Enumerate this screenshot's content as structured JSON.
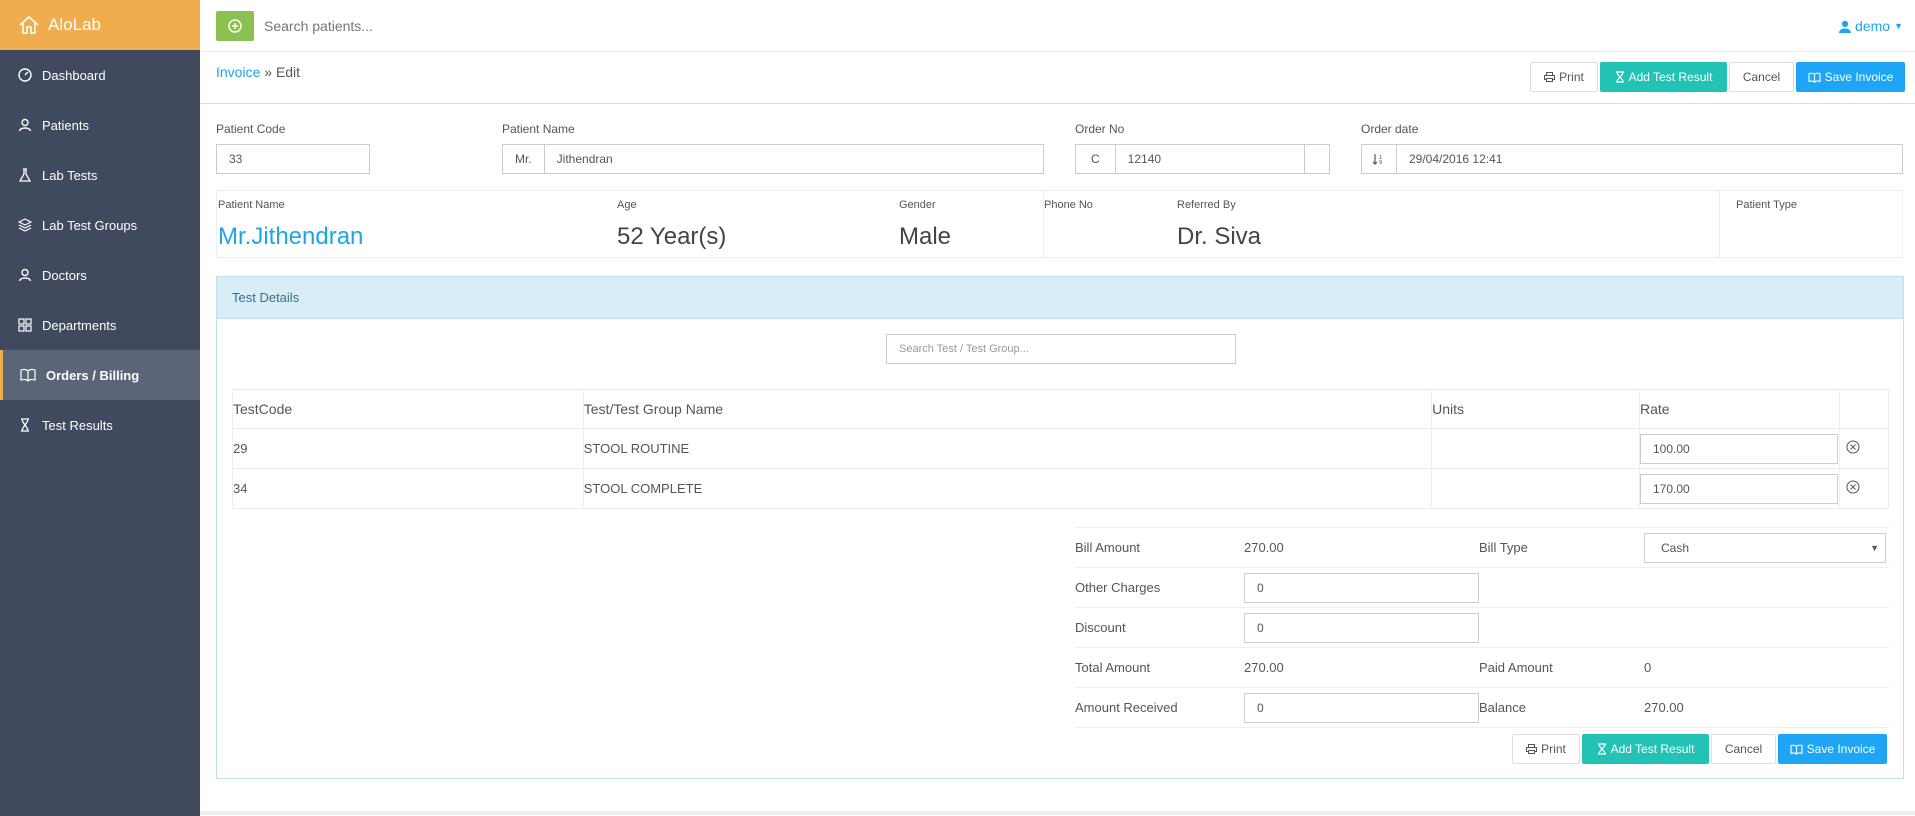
{
  "app": {
    "title": "AloLab"
  },
  "sidebar": {
    "items": [
      {
        "label": "Dashboard",
        "icon": "dashboard-icon"
      },
      {
        "label": "Patients",
        "icon": "user-icon"
      },
      {
        "label": "Lab Tests",
        "icon": "flask-icon"
      },
      {
        "label": "Lab Test Groups",
        "icon": "layers-icon"
      },
      {
        "label": "Doctors",
        "icon": "doctor-icon"
      },
      {
        "label": "Departments",
        "icon": "grid-icon"
      },
      {
        "label": "Orders / Billing",
        "icon": "book-icon",
        "active": true
      },
      {
        "label": "Test Results",
        "icon": "hourglass-icon"
      }
    ]
  },
  "topbar": {
    "search_placeholder": "Search patients...",
    "user": "demo"
  },
  "breadcrumb": {
    "parent": "Invoice",
    "sep": " » ",
    "current": "Edit"
  },
  "buttons": {
    "print": "Print",
    "add_test_result": "Add Test Result",
    "cancel": "Cancel",
    "save_invoice": "Save Invoice"
  },
  "form": {
    "patient_code": {
      "label": "Patient Code",
      "value": "33"
    },
    "patient_name": {
      "label": "Patient Name",
      "prefix": "Mr.",
      "value": "Jithendran"
    },
    "order_no": {
      "label": "Order No",
      "prefix": "C",
      "value": "12140"
    },
    "order_date": {
      "label": "Order date",
      "value": "29/04/2016 12:41"
    }
  },
  "patient_info": {
    "name_label": "Patient Name",
    "name": "Mr.Jithendran",
    "age_label": "Age",
    "age": "52 Year(s)",
    "gender_label": "Gender",
    "gender": "Male",
    "phone_label": "Phone No",
    "phone": "",
    "referred_label": "Referred By",
    "referred": "Dr. Siva",
    "type_label": "Patient Type",
    "type": ""
  },
  "test_details": {
    "title": "Test Details",
    "search_placeholder": "Search Test / Test Group...",
    "columns": [
      "TestCode",
      "Test/Test Group Name",
      "Units",
      "Rate"
    ],
    "rows": [
      {
        "code": "29",
        "name": "STOOL ROUTINE",
        "units": "",
        "rate": "100.00"
      },
      {
        "code": "34",
        "name": "STOOL COMPLETE",
        "units": "",
        "rate": "170.00"
      }
    ]
  },
  "summary": {
    "bill_amount_label": "Bill Amount",
    "bill_amount": "270.00",
    "bill_type_label": "Bill Type",
    "bill_type": "Cash",
    "other_charges_label": "Other Charges",
    "other_charges": "0",
    "discount_label": "Discount",
    "discount": "0",
    "total_amount_label": "Total Amount",
    "total_amount": "270.00",
    "paid_amount_label": "Paid Amount",
    "paid_amount": "0",
    "amount_received_label": "Amount Received",
    "amount_received": "0",
    "balance_label": "Balance",
    "balance": "270.00"
  },
  "colors": {
    "brand": "#f0ad4e",
    "sidebar": "#3f4a5e",
    "teal": "#22c3b5",
    "blue": "#1ea5f5",
    "link": "#1ea5e8",
    "add": "#8cc152"
  }
}
